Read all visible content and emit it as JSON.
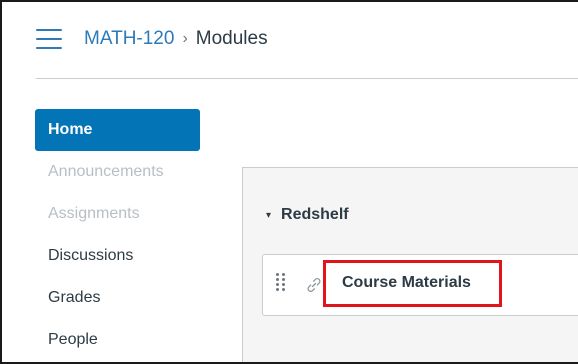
{
  "breadcrumb": {
    "course": "MATH-120",
    "separator": "›",
    "current": "Modules"
  },
  "icons": {
    "menu": "hamburger-menu-icon",
    "drag": "drag-handle-icon",
    "link": "link-icon"
  },
  "colors": {
    "accent": "#0374b5",
    "link": "#2d7ab8",
    "highlight_border": "#e0141b"
  },
  "nav": {
    "items": [
      {
        "label": "Home",
        "state": "active"
      },
      {
        "label": "Announcements",
        "state": "disabled"
      },
      {
        "label": "Assignments",
        "state": "disabled"
      },
      {
        "label": "Discussions",
        "state": "normal"
      },
      {
        "label": "Grades",
        "state": "normal"
      },
      {
        "label": "People",
        "state": "normal"
      }
    ]
  },
  "module": {
    "caret": "▾",
    "title": "Redshelf",
    "items": [
      {
        "title": "Course Materials",
        "type": "external-link"
      }
    ]
  }
}
